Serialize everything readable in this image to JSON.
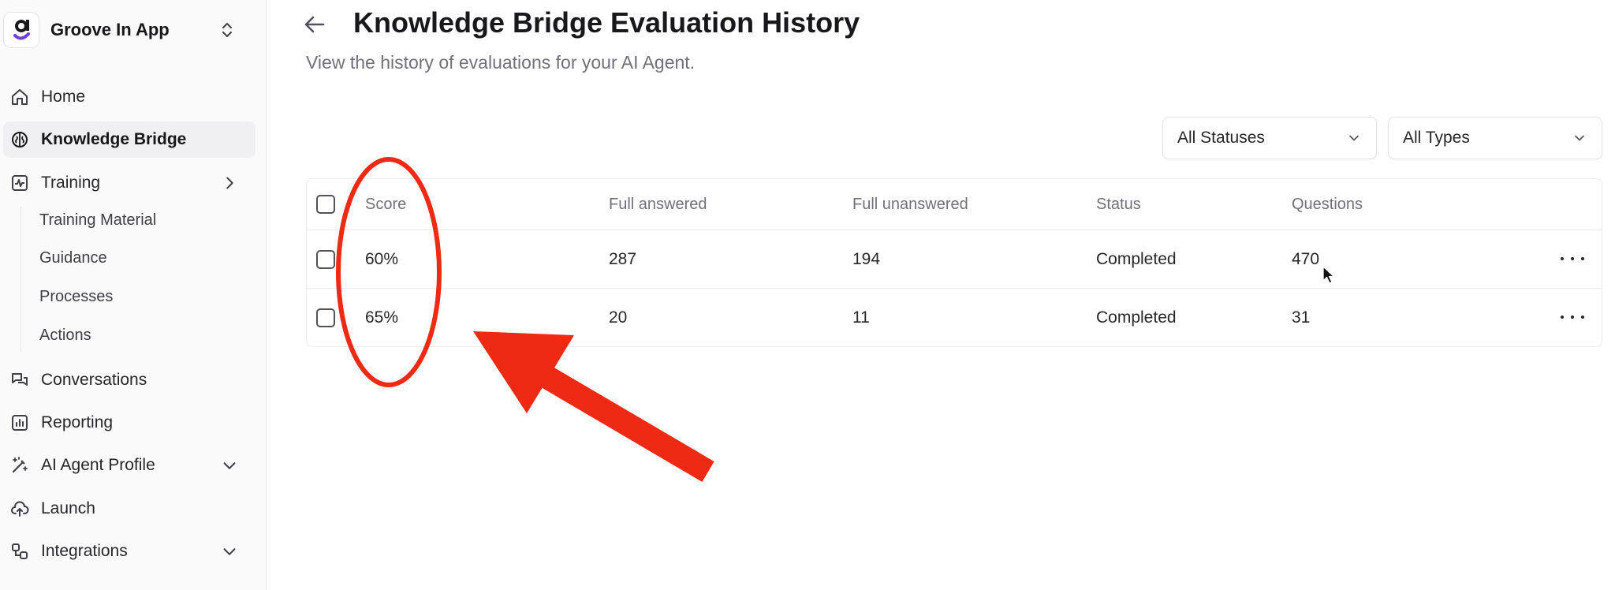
{
  "workspace": {
    "name": "Groove In App",
    "logo_letter": "g"
  },
  "sidebar": {
    "items": [
      {
        "label": "Home",
        "icon": "home-icon"
      },
      {
        "label": "Knowledge Bridge",
        "icon": "brain-icon",
        "active": true
      },
      {
        "label": "Training",
        "icon": "activity-icon",
        "chevron": "right"
      },
      {
        "label": "Conversations",
        "icon": "chat-icon"
      },
      {
        "label": "Reporting",
        "icon": "bar-chart-icon"
      },
      {
        "label": "AI Agent Profile",
        "icon": "magic-wand-icon",
        "chevron": "down"
      },
      {
        "label": "Launch",
        "icon": "cloud-upload-icon"
      },
      {
        "label": "Integrations",
        "icon": "integrations-icon",
        "chevron": "down"
      }
    ],
    "training_subitems": [
      "Training Material",
      "Guidance",
      "Processes",
      "Actions"
    ]
  },
  "page": {
    "title": "Knowledge Bridge Evaluation History",
    "subtitle": "View the history of evaluations for your AI Agent."
  },
  "filters": {
    "status": {
      "value": "All Statuses"
    },
    "type": {
      "value": "All Types"
    }
  },
  "table": {
    "columns": [
      "Score",
      "Full answered",
      "Full unanswered",
      "Status",
      "Questions"
    ],
    "rows": [
      {
        "score": "60%",
        "full_answered": "287",
        "full_unanswered": "194",
        "status": "Completed",
        "questions": "470"
      },
      {
        "score": "65%",
        "full_answered": "20",
        "full_unanswered": "11",
        "status": "Completed",
        "questions": "31"
      }
    ]
  },
  "colors": {
    "annotation_red": "#ee2a14",
    "accent_purple": "#6d3fd8",
    "text_primary": "#18181b",
    "text_muted": "#71717a"
  }
}
